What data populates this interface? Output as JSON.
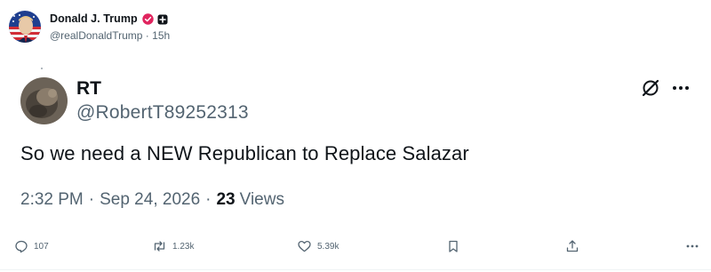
{
  "post": {
    "display_name": "Donald J. Trump",
    "handle": "@realDonaldTrump",
    "separator": "·",
    "time_ago": "15h",
    "verified_badge_icon": "verified-check-icon",
    "affiliate_badge_icon": "affiliate-badge-icon"
  },
  "quoted_post": {
    "display_name": "RT",
    "handle": "@RobertT89252313",
    "text": "So we need a NEW Republican to Replace Salazar",
    "time": "2:32 PM",
    "date": "Sep 24, 2026",
    "separator": "·",
    "views_count": "23",
    "views_label": "Views",
    "grok_icon": "grok-icon",
    "more_icon": "more-dots-icon"
  },
  "actions": {
    "reply_count": "107",
    "repost_count": "1.23k",
    "like_count": "5.39k"
  },
  "colors": {
    "text_primary": "#0f1419",
    "text_secondary": "#536471",
    "verified_badge": "#e0245e"
  }
}
